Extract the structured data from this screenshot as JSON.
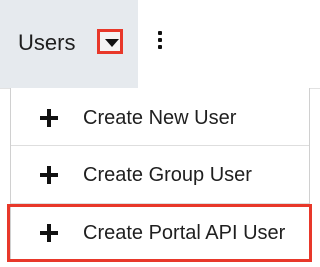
{
  "header": {
    "module_tab_label": "Users",
    "actions_caret_icon": "caret-down-icon",
    "more_actions_icon": "vertical-ellipsis-icon"
  },
  "menu": {
    "items": [
      {
        "label": "Create New User",
        "icon": "plus-icon"
      },
      {
        "label": "Create Group User",
        "icon": "plus-icon"
      },
      {
        "label": "Create Portal API User",
        "icon": "plus-icon"
      }
    ]
  },
  "colors": {
    "tab_background": "#e6eaee",
    "highlight": "#e8382a",
    "text": "#1f1f1f"
  }
}
